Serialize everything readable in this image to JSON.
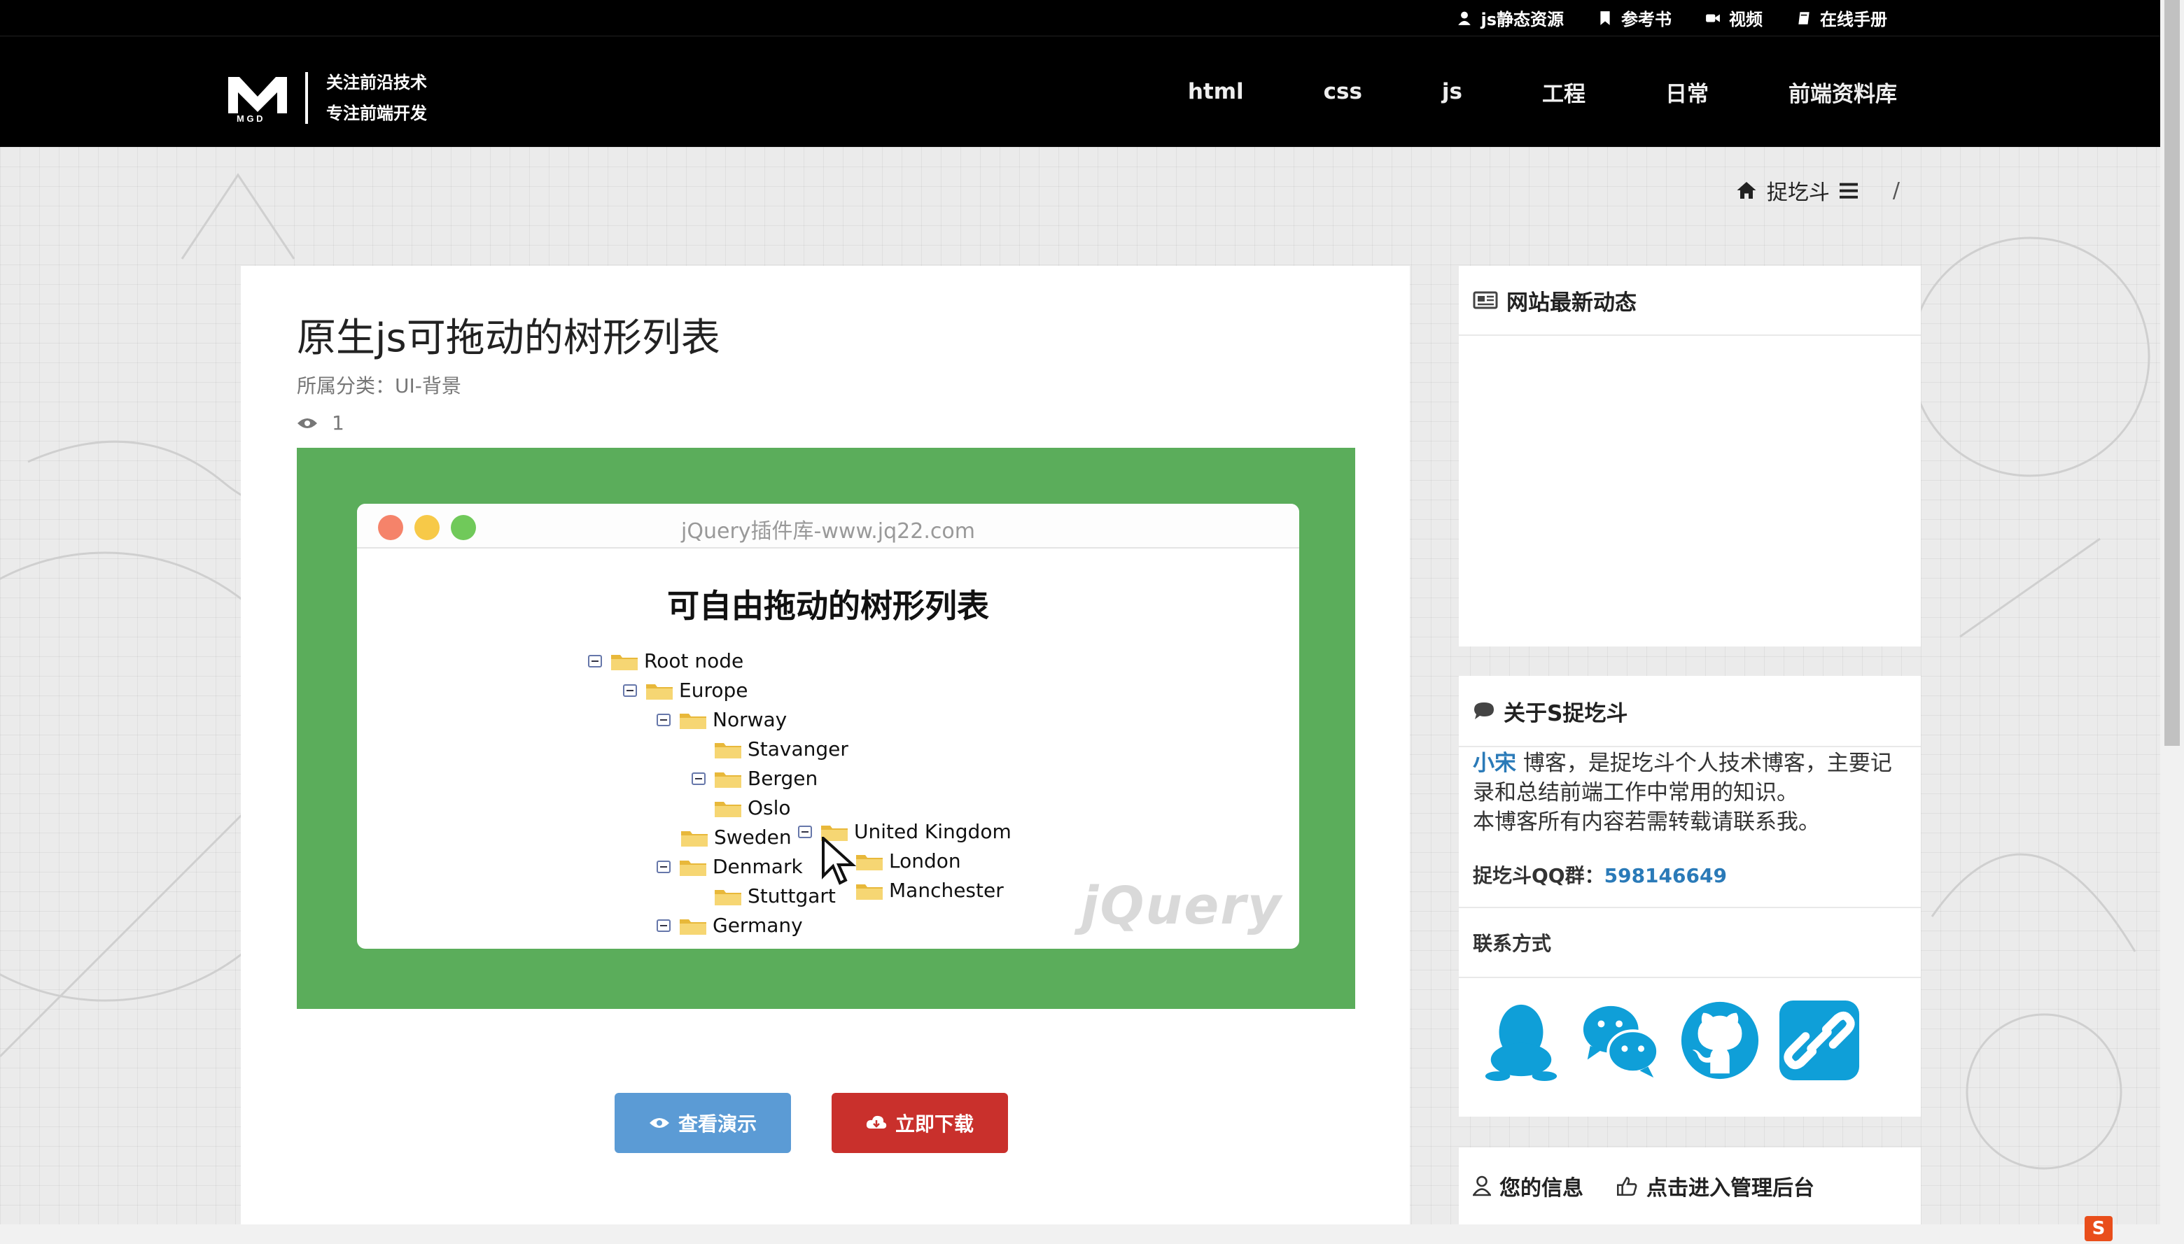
{
  "topbar": {
    "links": [
      {
        "label": "js静态资源",
        "icon": "user-icon"
      },
      {
        "label": "参考书",
        "icon": "bookmark-icon"
      },
      {
        "label": "视频",
        "icon": "video-camera-icon"
      },
      {
        "label": "在线手册",
        "icon": "book-icon"
      }
    ]
  },
  "header": {
    "logo_letters": "M G D",
    "slogan_line1": "关注前沿技术",
    "slogan_line2": "专注前端开发",
    "nav": [
      "html",
      "css",
      "js",
      "工程",
      "日常",
      "前端资料库"
    ]
  },
  "breadcrumb": {
    "home": "捉圪斗",
    "separator": "/"
  },
  "article": {
    "title": "原生js可拖动的树形列表",
    "category": "所属分类：UI-背景",
    "views": "1",
    "preview": {
      "url": "jQuery插件库-www.jq22.com",
      "heading": "可自由拖动的树形列表",
      "tree": [
        "Root node",
        "Europe",
        "Norway",
        "Stavanger",
        "Bergen",
        "Oslo",
        "Sweden",
        "United Kingdom",
        "London",
        "Manchester",
        "Denmark",
        "Stuttgart",
        "Germany"
      ],
      "watermark": "jQuery"
    },
    "demo_button": "查看演示",
    "download_button": "立即下载"
  },
  "sidebar": {
    "news_title": "网站最新动态",
    "about_title": "关于S捉圪斗",
    "about_name": "小宋",
    "about_text": " 博客，是捉圪斗个人技术博客，主要记录和总结前端工作中常用的知识。",
    "about_text2": "本博客所有内容若需转载请联系我。",
    "qq_label": "捉圪斗QQ群：",
    "qq_number": "598146649",
    "contact_title": "联系方式",
    "social": [
      "qq-icon",
      "wechat-icon",
      "github-icon",
      "link-icon"
    ],
    "user_info": "您的信息",
    "admin_link": "点击进入管理后台"
  },
  "colors": {
    "header_bg": "#000000",
    "preview_bg": "#5bad5b",
    "demo_button": "#5b9bd5",
    "download_button": "#c9302c",
    "link_blue": "#2a7ab8",
    "social_blue": "#0f9fd8"
  }
}
